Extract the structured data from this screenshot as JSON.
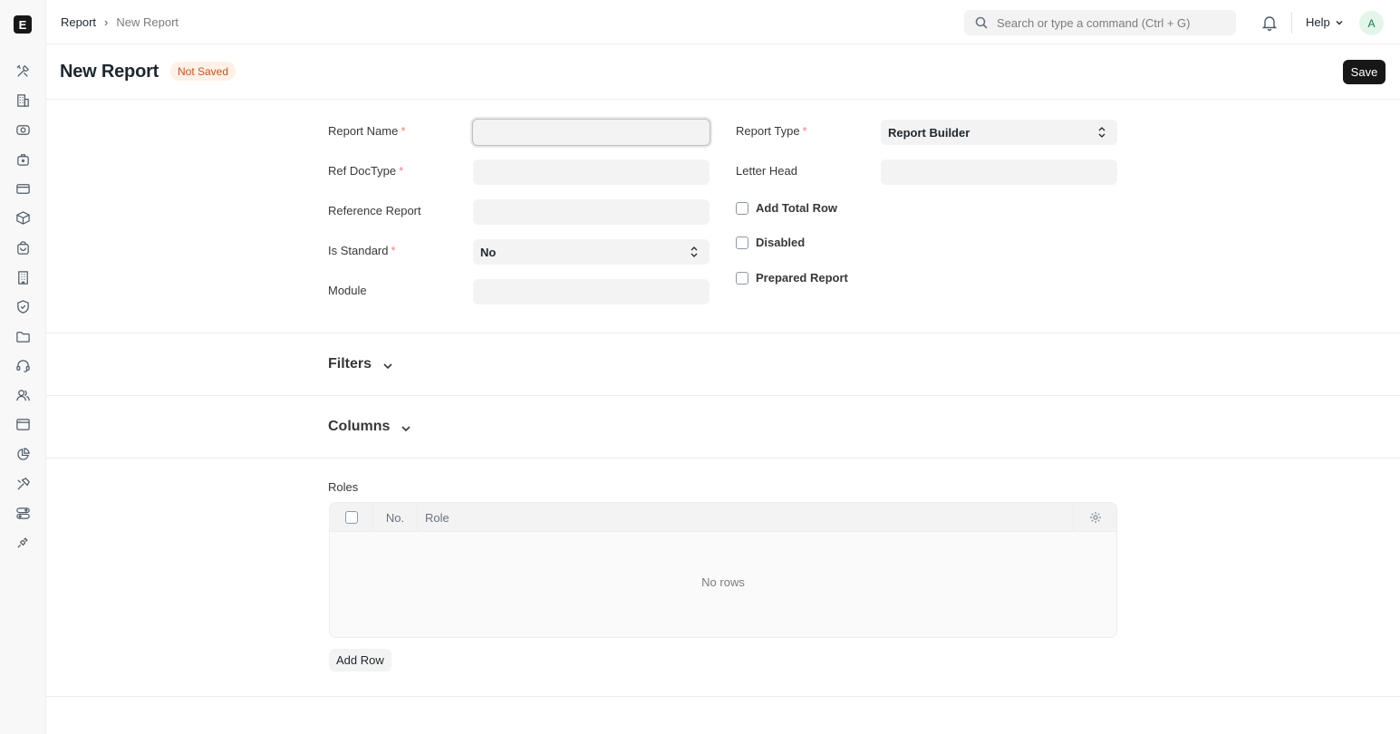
{
  "app": {
    "logo_letter": "E"
  },
  "sidebar": {
    "icons": [
      "tools-icon",
      "building-icon",
      "eye-icon",
      "briefcase-icon",
      "card-icon",
      "package-icon",
      "bag-icon",
      "office-icon",
      "shield-icon",
      "folder-icon",
      "headset-icon",
      "users-icon",
      "window-icon",
      "piechart-icon",
      "hammer-icon",
      "toggle-icon",
      "plug-icon"
    ]
  },
  "navbar": {
    "breadcrumb": {
      "parent": "Report",
      "current": "New Report"
    },
    "search_placeholder": "Search or type a command (Ctrl + G)",
    "help_label": "Help",
    "avatar_initial": "A"
  },
  "page": {
    "title": "New Report",
    "status": "Not Saved",
    "save_label": "Save"
  },
  "form": {
    "left": {
      "report_name_label": "Report Name",
      "report_name_value": "",
      "ref_doctype_label": "Ref DocType",
      "ref_doctype_value": "",
      "reference_report_label": "Reference Report",
      "reference_report_value": "",
      "is_standard_label": "Is Standard",
      "is_standard_value": "No",
      "module_label": "Module",
      "module_value": ""
    },
    "right": {
      "report_type_label": "Report Type",
      "report_type_value": "Report Builder",
      "letter_head_label": "Letter Head",
      "letter_head_value": "",
      "add_total_row_label": "Add Total Row",
      "disabled_label": "Disabled",
      "prepared_report_label": "Prepared Report"
    },
    "required_mark": "*"
  },
  "sections": {
    "filters": "Filters",
    "columns": "Columns"
  },
  "roles": {
    "label": "Roles",
    "headers": {
      "no": "No.",
      "role": "Role"
    },
    "empty_text": "No rows",
    "add_row_label": "Add Row"
  }
}
